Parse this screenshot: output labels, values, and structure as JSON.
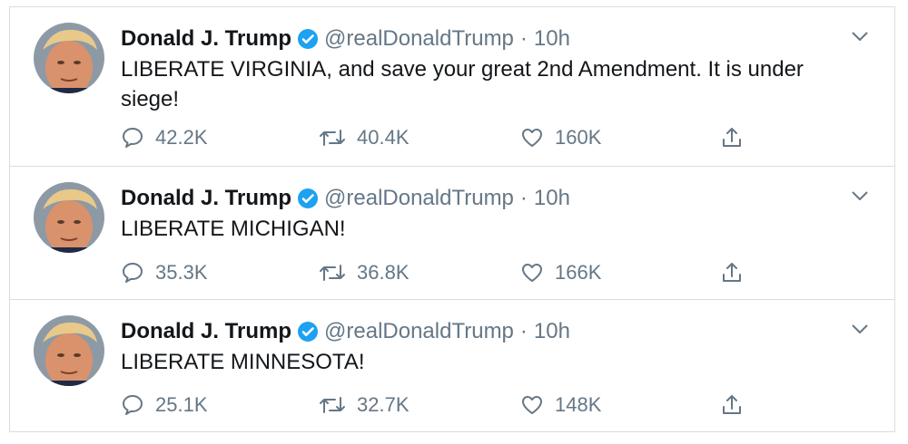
{
  "colors": {
    "verified": "#1da1f2",
    "text": "#14171a",
    "muted": "#657786",
    "divider": "#d8dde3"
  },
  "icons": {
    "verified": "verified-badge-icon",
    "caret": "chevron-down-icon",
    "reply": "reply-icon",
    "retweet": "retweet-icon",
    "like": "heart-icon",
    "share": "share-icon"
  },
  "tweets": [
    {
      "name": "Donald J. Trump",
      "handle": "@realDonaldTrump",
      "separator": "·",
      "time": "10h",
      "text": "LIBERATE VIRGINIA, and save your great 2nd Amendment. It is under siege!",
      "replies": "42.2K",
      "retweets": "40.4K",
      "likes": "160K"
    },
    {
      "name": "Donald J. Trump",
      "handle": "@realDonaldTrump",
      "separator": "·",
      "time": "10h",
      "text": "LIBERATE MICHIGAN!",
      "replies": "35.3K",
      "retweets": "36.8K",
      "likes": "166K"
    },
    {
      "name": "Donald J. Trump",
      "handle": "@realDonaldTrump",
      "separator": "·",
      "time": "10h",
      "text": "LIBERATE MINNESOTA!",
      "replies": "25.1K",
      "retweets": "32.7K",
      "likes": "148K"
    }
  ]
}
